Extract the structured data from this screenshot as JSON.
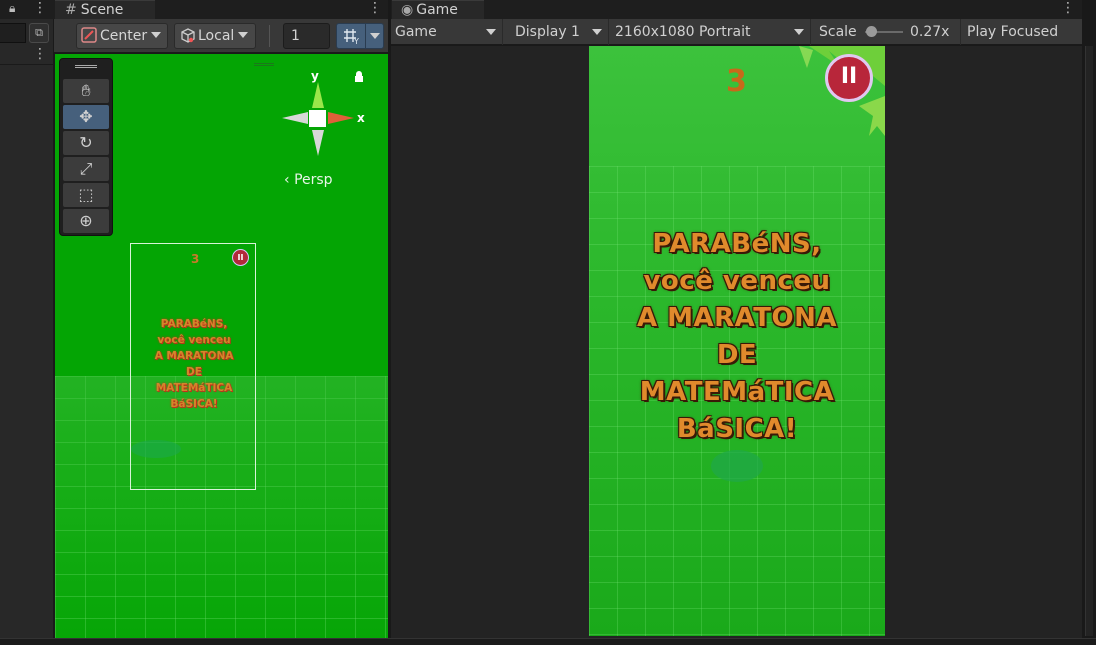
{
  "scene": {
    "tab_label": "Scene",
    "pivot_label": "Center",
    "space_label": "Local",
    "snap_value": "1",
    "persp_label": "Persp",
    "axis_y": "y",
    "axis_x": "x",
    "tools": [
      "hand-tool-icon",
      "move-tool-icon",
      "rotate-tool-icon",
      "scale-tool-icon",
      "rect-tool-icon",
      "transform-tool-icon"
    ],
    "preview": {
      "score": "3",
      "message_lines": [
        "PARABéNS,",
        "você venceu",
        "A MARATONA",
        "DE",
        "MATEMáTICA",
        "BáSICA!"
      ]
    }
  },
  "game": {
    "tab_label": "Game",
    "mode_label": "Game",
    "display_label": "Display 1",
    "resolution_label": "2160x1080 Portrait",
    "scale_label": "Scale",
    "scale_value": "0.27x",
    "play_mode_label": "Play Focused",
    "screen": {
      "score": "3",
      "message_lines": [
        "PARABéNS,",
        "você venceu",
        "A MARATONA",
        "DE",
        "MATEMáTICA",
        "BáSICA!"
      ]
    }
  },
  "colors": {
    "scene_bg": "#04a504",
    "game_green": "#2cb82c",
    "accent_blue": "#46607c",
    "text_orange": "#e08a2c"
  }
}
